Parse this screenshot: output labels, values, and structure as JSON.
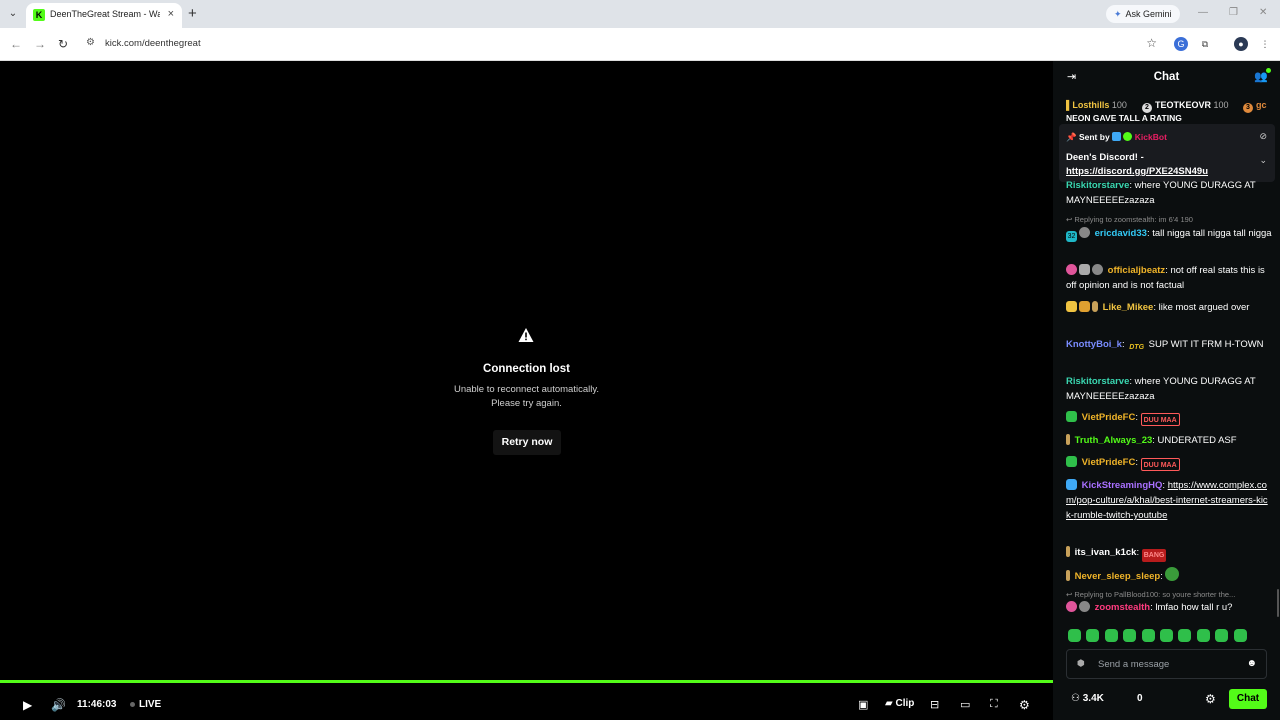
{
  "browser": {
    "tab_title": "DeenTheGreat Stream - Watch",
    "tab_favicon": "K",
    "url": "kick.com/deenthegreat",
    "gemini_label": "Ask Gemini"
  },
  "video": {
    "error_title": "Connection lost",
    "error_line1": "Unable to reconnect automatically.",
    "error_line2": "Please try again.",
    "retry_label": "Retry now",
    "time": "11:46:03",
    "live_label": "LIVE",
    "clip_label": "Clip"
  },
  "chat": {
    "title": "Chat",
    "leaderboard": [
      {
        "name": "Losthills",
        "count": "100",
        "badge": "",
        "color": "#f0c341"
      },
      {
        "name": "TEOTKEOVR",
        "count": "100",
        "badge": "2",
        "color": "#ffffff"
      },
      {
        "name": "gc",
        "count": "",
        "badge": "3",
        "color": "#e08a3c"
      }
    ],
    "cut_line": "NEON GAVE TALL A RATING",
    "pinned": {
      "sent_by": "Sent by",
      "sender": "KickBot",
      "line1": "Deen's Discord! -",
      "link": "https://discord.gg/PXE24SN49u"
    },
    "messages": [
      {
        "user": "Riskitorstarve",
        "color": "#3ad6b0",
        "text": "where YOUNG DURAGG AT MAYNEEEEEzazaza"
      },
      {
        "reply": "Replying to zoomstealth: im 6'4 190",
        "user": "ericdavid33",
        "color": "#33c9f5",
        "text": "tall nigga tall nigga tall nigga"
      },
      {
        "user": "officialjbeatz",
        "color": "#f0b429",
        "text": "not off real stats this is off opinion and is not factual"
      },
      {
        "user": "Like_Mikee",
        "color": "#f0c341",
        "text": "like most argued over"
      },
      {
        "user": "KnottyBoi_k",
        "color": "#7a8cff",
        "emote": "DTG",
        "text": "SUP WIT IT FRM H-TOWN"
      },
      {
        "user": "Riskitorstarve",
        "color": "#3ad6b0",
        "text": "where YOUNG DURAGG AT MAYNEEEEEzazaza"
      },
      {
        "user": "VietPrideFC",
        "color": "#f0b429",
        "emote": "DUU MAA"
      },
      {
        "user": "Truth_Always_23",
        "color": "#53fc18",
        "text": "UNDERATED ASF"
      },
      {
        "user": "VietPrideFC",
        "color": "#f0b429",
        "emote": "DUU MAA"
      },
      {
        "user": "KickStreamingHQ",
        "color": "#a970ff",
        "link": "https://www.complex.com/pop-culture/a/khal/best-internet-streamers-kick-rumble-twitch-youtube"
      },
      {
        "user": "its_ivan_k1ck",
        "color": "#ffffff",
        "emote": "BANG"
      },
      {
        "user": "Never_sleep_sleep",
        "color": "#f0b429"
      },
      {
        "reply": "Replying to PallBlood100: so youre shorter the...",
        "user": "zoomstealth",
        "color": "#ff3b7f",
        "text": "lmfao how tall r u?"
      }
    ],
    "input_placeholder": "Send a message",
    "viewers": "3.4K",
    "points": "0",
    "chat_button": "Chat"
  },
  "colors": {
    "accent": "#53fc18",
    "chat_bg": "#0b0e0f"
  }
}
